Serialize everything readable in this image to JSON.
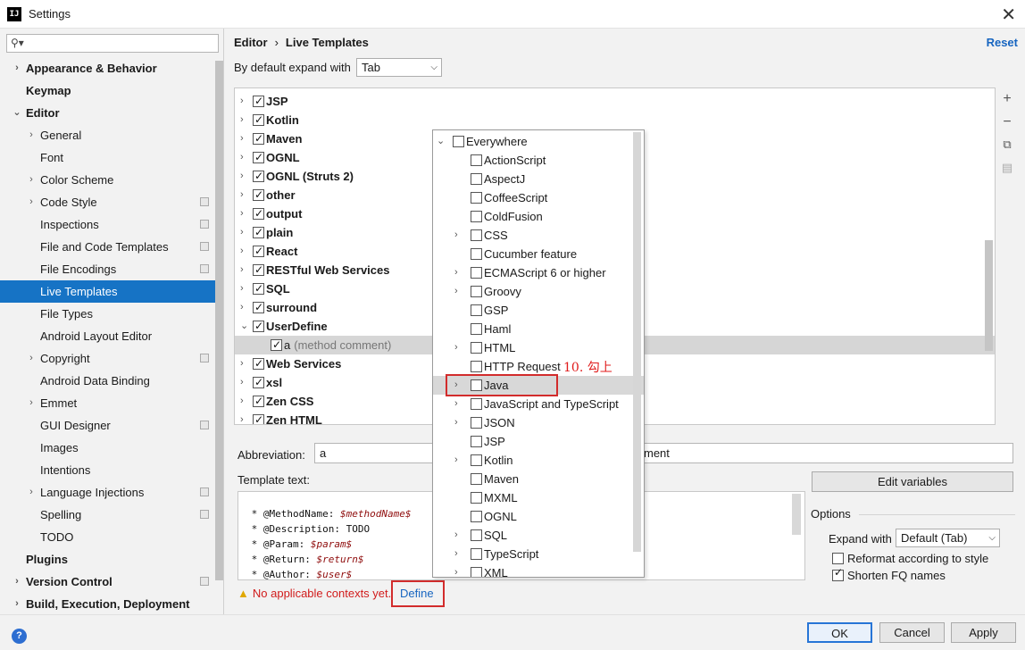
{
  "window": {
    "app_icon": "IJ",
    "title": "Settings",
    "close_label": "✕"
  },
  "search": {
    "placeholder": "",
    "icon": "search-icon"
  },
  "nav": [
    {
      "label": "Appearance & Behavior",
      "level": 0,
      "arrow": "›",
      "bold": true
    },
    {
      "label": "Keymap",
      "level": 0,
      "arrow": "",
      "bold": true
    },
    {
      "label": "Editor",
      "level": 0,
      "arrow": "⌄",
      "bold": true
    },
    {
      "label": "General",
      "level": 1,
      "arrow": "›"
    },
    {
      "label": "Font",
      "level": 1,
      "arrow": ""
    },
    {
      "label": "Color Scheme",
      "level": 1,
      "arrow": "›"
    },
    {
      "label": "Code Style",
      "level": 1,
      "arrow": "›",
      "copy": true
    },
    {
      "label": "Inspections",
      "level": 1,
      "arrow": "",
      "copy": true
    },
    {
      "label": "File and Code Templates",
      "level": 1,
      "arrow": "",
      "copy": true
    },
    {
      "label": "File Encodings",
      "level": 1,
      "arrow": "",
      "copy": true
    },
    {
      "label": "Live Templates",
      "level": 1,
      "arrow": "",
      "selected": true
    },
    {
      "label": "File Types",
      "level": 1,
      "arrow": ""
    },
    {
      "label": "Android Layout Editor",
      "level": 1,
      "arrow": ""
    },
    {
      "label": "Copyright",
      "level": 1,
      "arrow": "›",
      "copy": true
    },
    {
      "label": "Android Data Binding",
      "level": 1,
      "arrow": ""
    },
    {
      "label": "Emmet",
      "level": 1,
      "arrow": "›"
    },
    {
      "label": "GUI Designer",
      "level": 1,
      "arrow": "",
      "copy": true
    },
    {
      "label": "Images",
      "level": 1,
      "arrow": ""
    },
    {
      "label": "Intentions",
      "level": 1,
      "arrow": ""
    },
    {
      "label": "Language Injections",
      "level": 1,
      "arrow": "›",
      "copy": true
    },
    {
      "label": "Spelling",
      "level": 1,
      "arrow": "",
      "copy": true
    },
    {
      "label": "TODO",
      "level": 1,
      "arrow": ""
    },
    {
      "label": "Plugins",
      "level": 0,
      "arrow": "",
      "bold": true
    },
    {
      "label": "Version Control",
      "level": 0,
      "arrow": "›",
      "bold": true,
      "copy": true
    },
    {
      "label": "Build, Execution, Deployment",
      "level": 0,
      "arrow": "›",
      "bold": true
    }
  ],
  "main": {
    "breadcrumb_parent": "Editor",
    "breadcrumb_sep": "›",
    "breadcrumb_current": "Live Templates",
    "reset_label": "Reset",
    "expand_label": "By default expand with",
    "expand_value": "Tab",
    "caret": "⌵"
  },
  "template_groups": [
    {
      "label": "JSP",
      "checked": true,
      "arrow": "›"
    },
    {
      "label": "Kotlin",
      "checked": true,
      "arrow": "›"
    },
    {
      "label": "Maven",
      "checked": true,
      "arrow": "›"
    },
    {
      "label": "OGNL",
      "checked": true,
      "arrow": "›"
    },
    {
      "label": "OGNL (Struts 2)",
      "checked": true,
      "arrow": "›"
    },
    {
      "label": "other",
      "checked": true,
      "arrow": "›"
    },
    {
      "label": "output",
      "checked": true,
      "arrow": "›"
    },
    {
      "label": "plain",
      "checked": true,
      "arrow": "›"
    },
    {
      "label": "React",
      "checked": true,
      "arrow": "›"
    },
    {
      "label": "RESTful Web Services",
      "checked": true,
      "arrow": "›"
    },
    {
      "label": "SQL",
      "checked": true,
      "arrow": "›"
    },
    {
      "label": "surround",
      "checked": true,
      "arrow": "›"
    },
    {
      "label": "UserDefine",
      "checked": true,
      "arrow": "⌄"
    },
    {
      "label": "a",
      "desc": "(method comment)",
      "checked": true,
      "arrow": "",
      "child": true
    },
    {
      "label": "Web Services",
      "checked": true,
      "arrow": "›"
    },
    {
      "label": "xsl",
      "checked": true,
      "arrow": "›"
    },
    {
      "label": "Zen CSS",
      "checked": true,
      "arrow": "›"
    },
    {
      "label": "Zen HTML",
      "checked": true,
      "arrow": "›"
    }
  ],
  "tools": [
    "+",
    "−",
    "⧉",
    "▤"
  ],
  "abbreviation": {
    "label": "Abbreviation:",
    "value": "a",
    "description_value": "ment"
  },
  "template_text": {
    "label": "Template text:",
    "lines": [
      {
        "prefix": " * @MethodName: ",
        "var": "$methodName$"
      },
      {
        "prefix": " * @Description: TODO",
        "var": ""
      },
      {
        "prefix": " * @Param: ",
        "var": "$param$"
      },
      {
        "prefix": " * @Return: ",
        "var": "$return$"
      },
      {
        "prefix": " * @Author: ",
        "var": "$user$"
      }
    ]
  },
  "warning": {
    "icon": "warning-icon",
    "glyph": "▲",
    "text": "No applicable contexts yet.",
    "define_label": "Define"
  },
  "edit_variables_label": "Edit variables",
  "options": {
    "title": "Options",
    "expand_with_label": "Expand with",
    "expand_with_value": "Default (Tab)",
    "reformat_label": "Reformat according to style",
    "reformat_checked": false,
    "shorten_label": "Shorten FQ names",
    "shorten_checked": true
  },
  "contexts_popup": [
    {
      "label": "Everywhere",
      "level": 0,
      "arrow": "⌄",
      "checked": false
    },
    {
      "label": "ActionScript",
      "level": 1,
      "arrow": "",
      "checked": false
    },
    {
      "label": "AspectJ",
      "level": 1,
      "arrow": "",
      "checked": false
    },
    {
      "label": "CoffeeScript",
      "level": 1,
      "arrow": "",
      "checked": false
    },
    {
      "label": "ColdFusion",
      "level": 1,
      "arrow": "",
      "checked": false
    },
    {
      "label": "CSS",
      "level": 1,
      "arrow": "›",
      "checked": false
    },
    {
      "label": "Cucumber feature",
      "level": 1,
      "arrow": "",
      "checked": false
    },
    {
      "label": "ECMAScript 6 or higher",
      "level": 1,
      "arrow": "›",
      "checked": false
    },
    {
      "label": "Groovy",
      "level": 1,
      "arrow": "›",
      "checked": false
    },
    {
      "label": "GSP",
      "level": 1,
      "arrow": "",
      "checked": false
    },
    {
      "label": "Haml",
      "level": 1,
      "arrow": "",
      "checked": false
    },
    {
      "label": "HTML",
      "level": 1,
      "arrow": "›",
      "checked": false
    },
    {
      "label": "HTTP Request",
      "level": 1,
      "arrow": "",
      "checked": false
    },
    {
      "label": "Java",
      "level": 1,
      "arrow": "›",
      "checked": false,
      "highlight": true
    },
    {
      "label": "JavaScript and TypeScript",
      "level": 1,
      "arrow": "›",
      "checked": false
    },
    {
      "label": "JSON",
      "level": 1,
      "arrow": "›",
      "checked": false
    },
    {
      "label": "JSP",
      "level": 1,
      "arrow": "",
      "checked": false
    },
    {
      "label": "Kotlin",
      "level": 1,
      "arrow": "›",
      "checked": false
    },
    {
      "label": "Maven",
      "level": 1,
      "arrow": "",
      "checked": false
    },
    {
      "label": "MXML",
      "level": 1,
      "arrow": "",
      "checked": false
    },
    {
      "label": "OGNL",
      "level": 1,
      "arrow": "",
      "checked": false
    },
    {
      "label": "SQL",
      "level": 1,
      "arrow": "›",
      "checked": false
    },
    {
      "label": "TypeScript",
      "level": 1,
      "arrow": "›",
      "checked": false
    },
    {
      "label": "XML",
      "level": 1,
      "arrow": "›",
      "checked": false
    }
  ],
  "annotation_text": "10. 勾上",
  "buttons": {
    "help": "?",
    "ok": "OK",
    "cancel": "Cancel",
    "apply": "Apply"
  },
  "colors": {
    "selection": "#1673c5",
    "link": "#1765c0",
    "error": "#d11c1c",
    "annotation": "#e01b1b"
  }
}
